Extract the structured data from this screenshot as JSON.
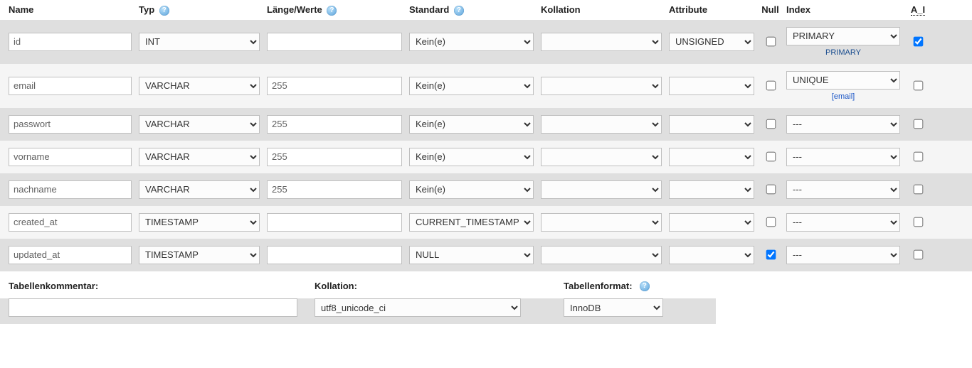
{
  "headers": {
    "name": "Name",
    "typ": "Typ",
    "len": "Länge/Werte",
    "std": "Standard",
    "koll": "Kollation",
    "attr": "Attribute",
    "null": "Null",
    "index": "Index",
    "ai": "A_I"
  },
  "rows": [
    {
      "name": "id",
      "typ": "INT",
      "len": "",
      "std": "Kein(e)",
      "koll": "",
      "attr": "UNSIGNED",
      "null": false,
      "index": "PRIMARY",
      "index_sub": "PRIMARY",
      "index_sub_link": false,
      "ai": true,
      "alt": true
    },
    {
      "name": "email",
      "typ": "VARCHAR",
      "len": "255",
      "std": "Kein(e)",
      "koll": "",
      "attr": "",
      "null": false,
      "index": "UNIQUE",
      "index_sub": "[email]",
      "index_sub_link": true,
      "ai": false,
      "alt": false
    },
    {
      "name": "passwort",
      "typ": "VARCHAR",
      "len": "255",
      "std": "Kein(e)",
      "koll": "",
      "attr": "",
      "null": false,
      "index": "---",
      "index_sub": "",
      "index_sub_link": false,
      "ai": false,
      "alt": true
    },
    {
      "name": "vorname",
      "typ": "VARCHAR",
      "len": "255",
      "std": "Kein(e)",
      "koll": "",
      "attr": "",
      "null": false,
      "index": "---",
      "index_sub": "",
      "index_sub_link": false,
      "ai": false,
      "alt": false
    },
    {
      "name": "nachname",
      "typ": "VARCHAR",
      "len": "255",
      "std": "Kein(e)",
      "koll": "",
      "attr": "",
      "null": false,
      "index": "---",
      "index_sub": "",
      "index_sub_link": false,
      "ai": false,
      "alt": true
    },
    {
      "name": "created_at",
      "typ": "TIMESTAMP",
      "len": "",
      "std": "CURRENT_TIMESTAMP",
      "koll": "",
      "attr": "",
      "null": false,
      "index": "---",
      "index_sub": "",
      "index_sub_link": false,
      "ai": false,
      "alt": false
    },
    {
      "name": "updated_at",
      "typ": "TIMESTAMP",
      "len": "",
      "std": "NULL",
      "koll": "",
      "attr": "",
      "null": true,
      "index": "---",
      "index_sub": "",
      "index_sub_link": false,
      "ai": false,
      "alt": true
    }
  ],
  "footer": {
    "comment_label": "Tabellenkommentar:",
    "collation_label": "Kollation:",
    "format_label": "Tabellenformat:",
    "comment_value": "",
    "collation_value": "utf8_unicode_ci",
    "format_value": "InnoDB"
  }
}
